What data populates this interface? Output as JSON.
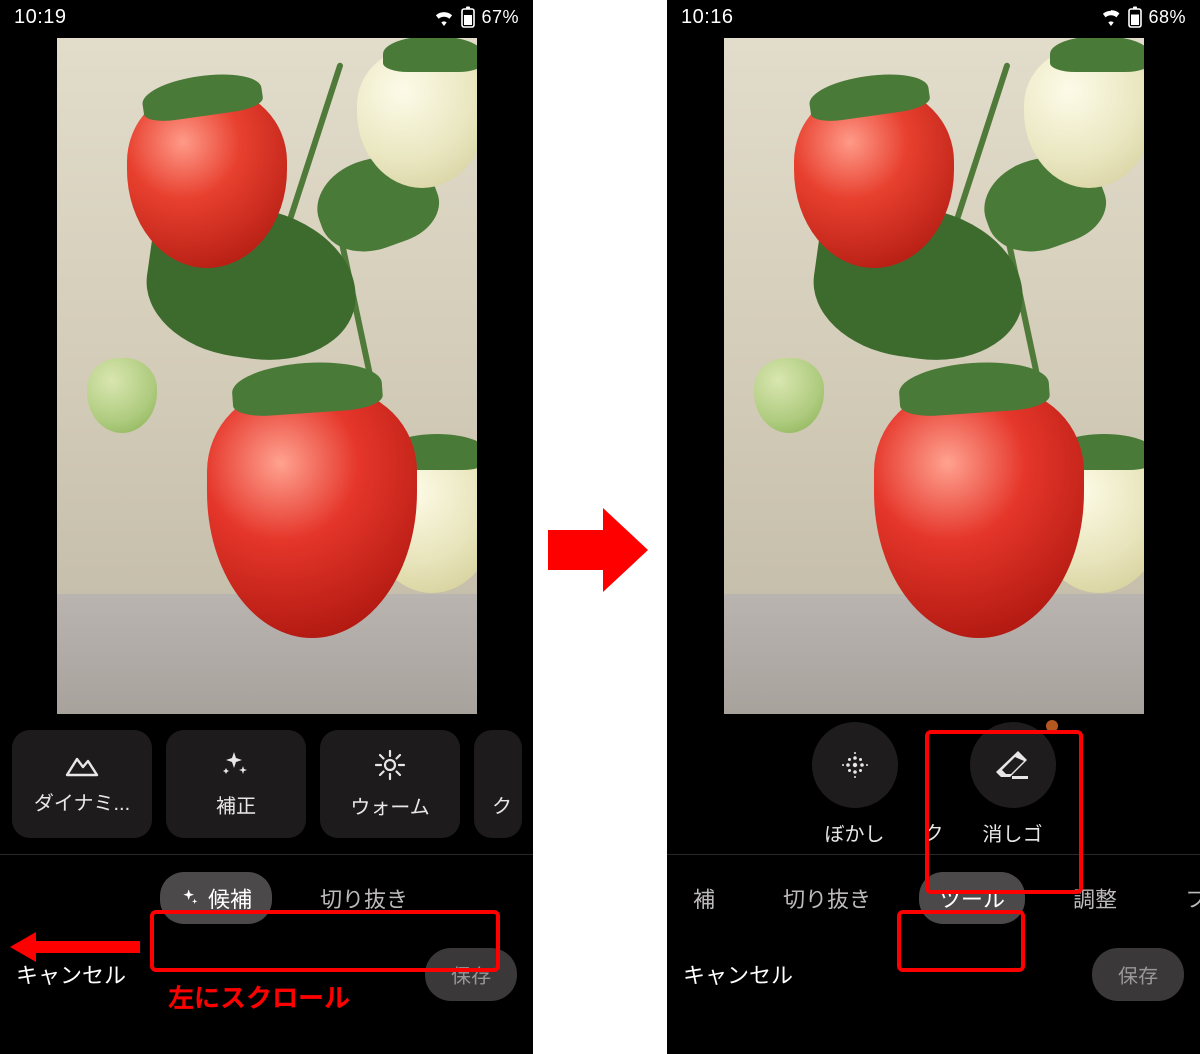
{
  "left": {
    "status": {
      "time": "10:19",
      "battery": "67%"
    },
    "chips": [
      {
        "label": "ダイナミ...",
        "icon": "mountain-icon"
      },
      {
        "label": "補正",
        "icon": "sparkle-icon"
      },
      {
        "label": "ウォーム",
        "icon": "sun-icon"
      },
      {
        "label": "ク",
        "icon": ""
      }
    ],
    "tabs": {
      "active": "候補",
      "items": [
        "候補",
        "切り抜き"
      ]
    },
    "bottom": {
      "cancel": "キャンセル",
      "save": "保存"
    }
  },
  "right": {
    "status": {
      "time": "10:16",
      "battery": "68%"
    },
    "tools": {
      "blur": "ぼかし",
      "partial_left": "ク",
      "eraser": "消しゴ"
    },
    "tabs": {
      "active": "ツール",
      "items": [
        "補",
        "切り抜き",
        "ツール",
        "調整",
        "フィル"
      ]
    },
    "bottom": {
      "cancel": "キャンセル",
      "save": "保存"
    }
  },
  "annotations": {
    "scroll_hint": "左にスクロール"
  }
}
